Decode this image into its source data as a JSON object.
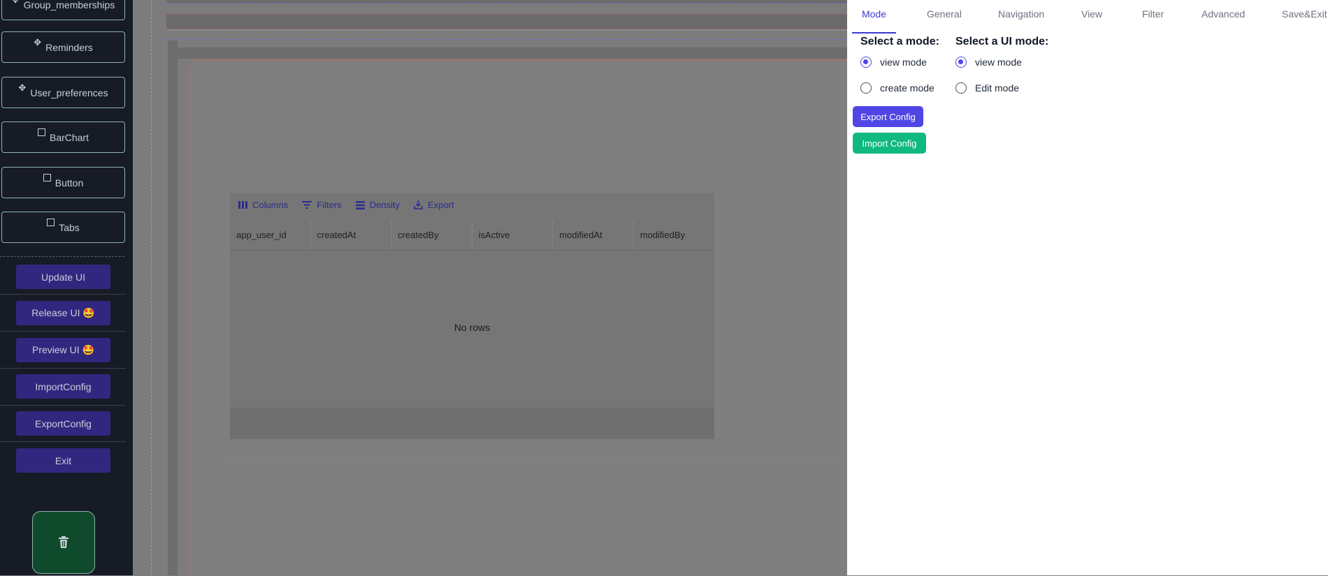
{
  "sidebar": {
    "components": [
      {
        "label": "Group_memberships",
        "icon": "move-icon"
      },
      {
        "label": "Reminders",
        "icon": "move-icon"
      },
      {
        "label": "User_preferences",
        "icon": "move-icon"
      },
      {
        "label": "BarChart",
        "icon": "square-icon"
      },
      {
        "label": "Button",
        "icon": "square-icon"
      },
      {
        "label": "Tabs",
        "icon": "square-icon"
      }
    ],
    "actions": [
      {
        "label": "Update UI"
      },
      {
        "label": "Release UI 🤩"
      },
      {
        "label": "Preview UI 🤩"
      },
      {
        "label": "ImportConfig"
      },
      {
        "label": "ExportConfig"
      },
      {
        "label": "Exit"
      }
    ],
    "trash_icon": "trash-icon"
  },
  "grid": {
    "toolbar": [
      {
        "label": "Columns",
        "icon": "columns-icon"
      },
      {
        "label": "Filters",
        "icon": "filter-icon"
      },
      {
        "label": "Density",
        "icon": "density-icon"
      },
      {
        "label": "Export",
        "icon": "export-icon"
      }
    ],
    "columns": [
      "app_user_id",
      "createdAt",
      "createdBy",
      "isActive",
      "modifiedAt",
      "modifiedBy"
    ],
    "empty_text": "No rows"
  },
  "panel": {
    "tabs": [
      "Mode",
      "General",
      "Navigation",
      "View",
      "Filter",
      "Advanced",
      "Save&Exit"
    ],
    "active_tab": "Mode",
    "mode_heading": "Select a mode:",
    "mode_options": [
      "view mode",
      "create mode"
    ],
    "mode_selected": "view mode",
    "ui_mode_heading": "Select a UI mode:",
    "ui_mode_options": [
      "view mode",
      "Edit mode"
    ],
    "ui_mode_selected": "view mode",
    "export_label": "Export Config",
    "import_label": "Import Config"
  },
  "colors": {
    "accent": "#4f46e5",
    "import_green": "#10b981",
    "sidebar_bg": "#161b26",
    "action_btn": "#31277f"
  }
}
